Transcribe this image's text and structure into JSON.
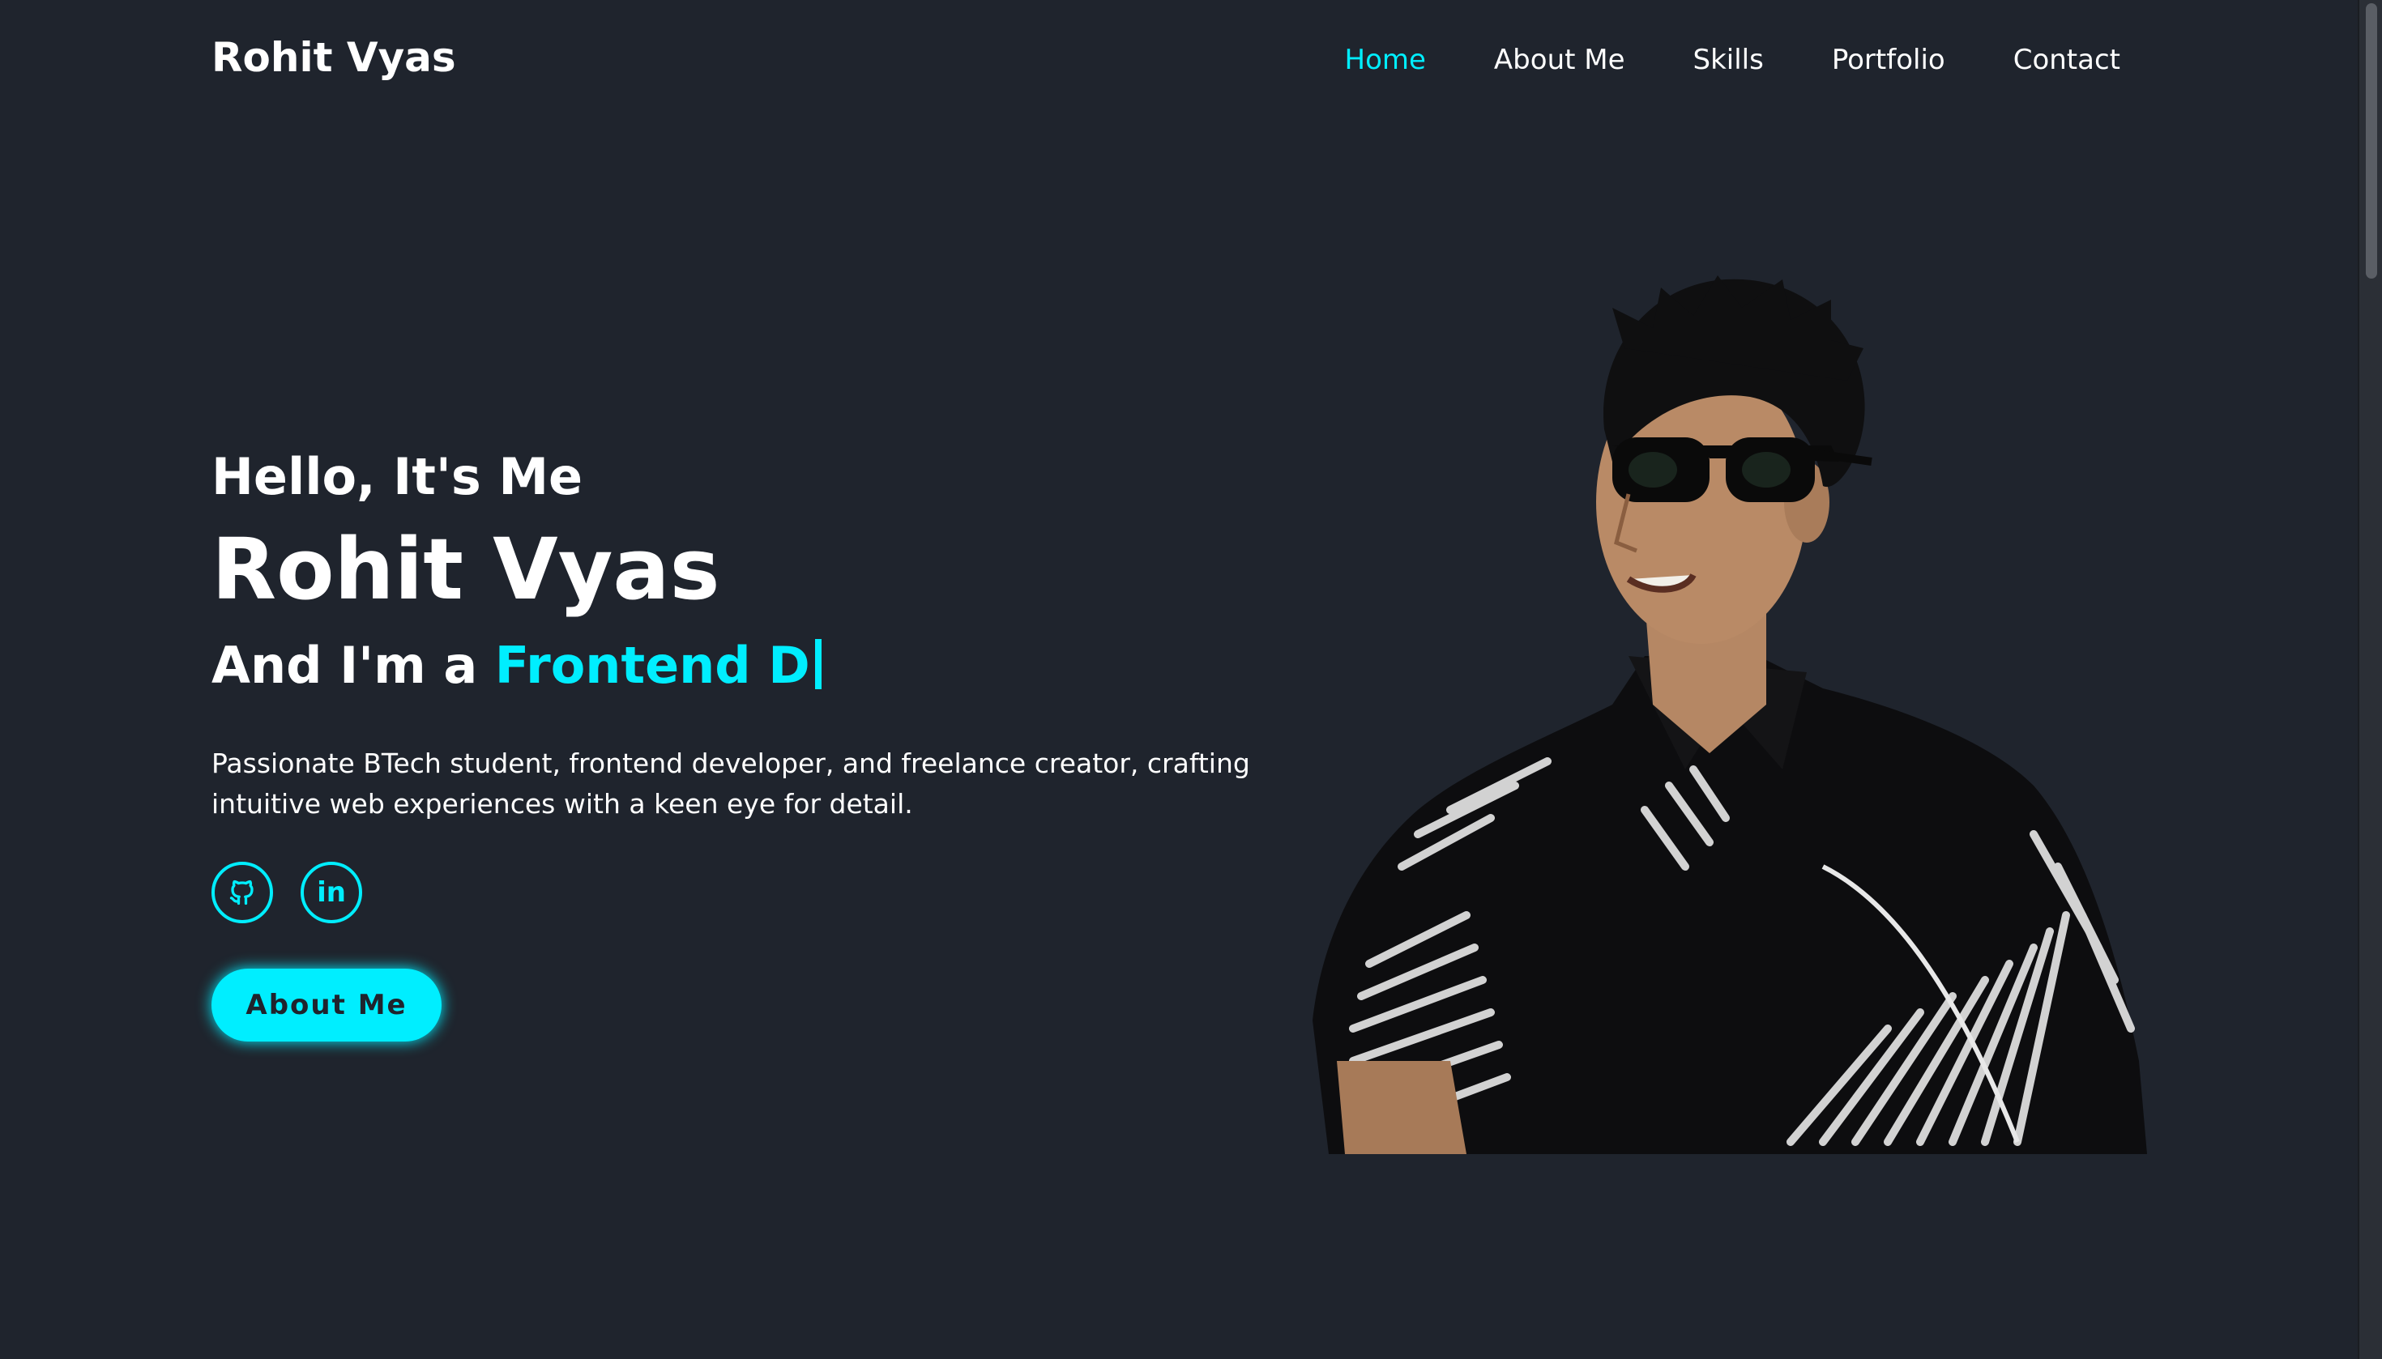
{
  "header": {
    "logo": "Rohit Vyas",
    "nav": [
      {
        "label": "Home",
        "active": true
      },
      {
        "label": "About Me",
        "active": false
      },
      {
        "label": "Skills",
        "active": false
      },
      {
        "label": "Portfolio",
        "active": false
      },
      {
        "label": "Contact",
        "active": false
      }
    ]
  },
  "hero": {
    "greeting": "Hello, It's Me",
    "name": "Rohit Vyas",
    "role_prefix": "And I'm a ",
    "role_typed": "Frontend D",
    "description": "Passionate BTech student, frontend developer, and freelance creator, crafting intuitive web experiences with a keen eye for detail.",
    "socials": [
      {
        "icon": "github-icon"
      },
      {
        "icon": "linkedin-icon",
        "label": "in"
      }
    ],
    "cta_label": "About Me"
  },
  "colors": {
    "background": "#1f242d",
    "accent": "#00eeff",
    "text": "#ffffff"
  }
}
